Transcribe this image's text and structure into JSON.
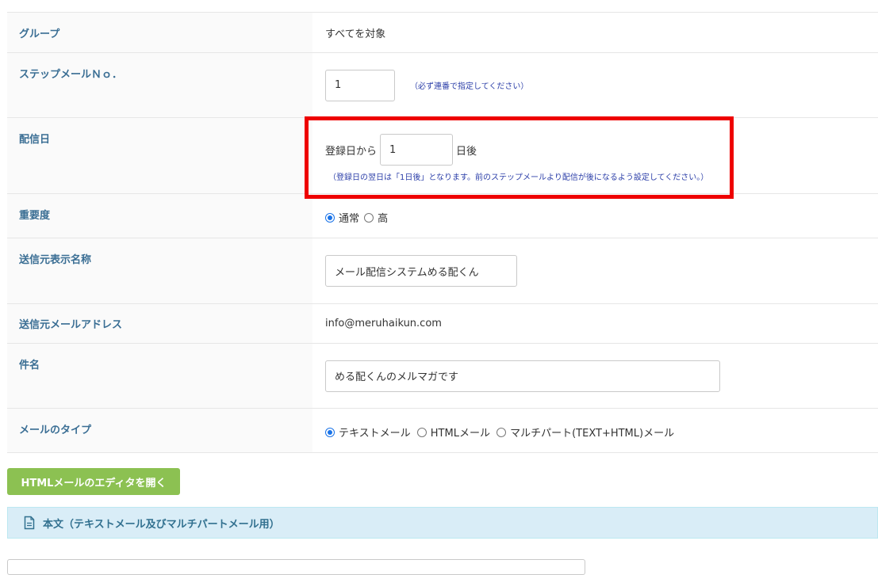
{
  "rows": {
    "group": {
      "label": "グループ",
      "value": "すべてを対象"
    },
    "step_no": {
      "label": "ステップメールＮｏ．",
      "input_value": "1",
      "hint": "（必ず連番で指定してください）"
    },
    "send_day": {
      "label": "配信日",
      "prefix": "登録日から",
      "input_value": "1",
      "suffix": "日後",
      "hint": "（登録日の翌日は「1日後」となります。前のステップメールより配信が後になるよう設定してください。）"
    },
    "priority": {
      "label": "重要度",
      "options": [
        "通常",
        "高"
      ],
      "selected": "通常"
    },
    "sender_name": {
      "label": "送信元表示名称",
      "input_value": "メール配信システムめる配くん"
    },
    "sender_address": {
      "label": "送信元メールアドレス",
      "value": "info@meruhaikun.com"
    },
    "subject": {
      "label": "件名",
      "input_value": "める配くんのメルマガです"
    },
    "mail_type": {
      "label": "メールのタイプ",
      "options": [
        "テキストメール",
        "HTMLメール",
        "マルチパート(TEXT+HTML)メール"
      ],
      "selected": "テキストメール"
    }
  },
  "html_editor_button": "HTMLメールのエディタを開く",
  "body_section": {
    "title": "本文（テキストメール及びマルチパートメール用）",
    "icon": "document-icon"
  },
  "colors": {
    "label": "#3a6e94",
    "hint": "#2b3ea8",
    "button": "#8cc152",
    "section_bg": "#d9edf7",
    "highlight": "#ee0000",
    "radio": "#1a73e8"
  }
}
